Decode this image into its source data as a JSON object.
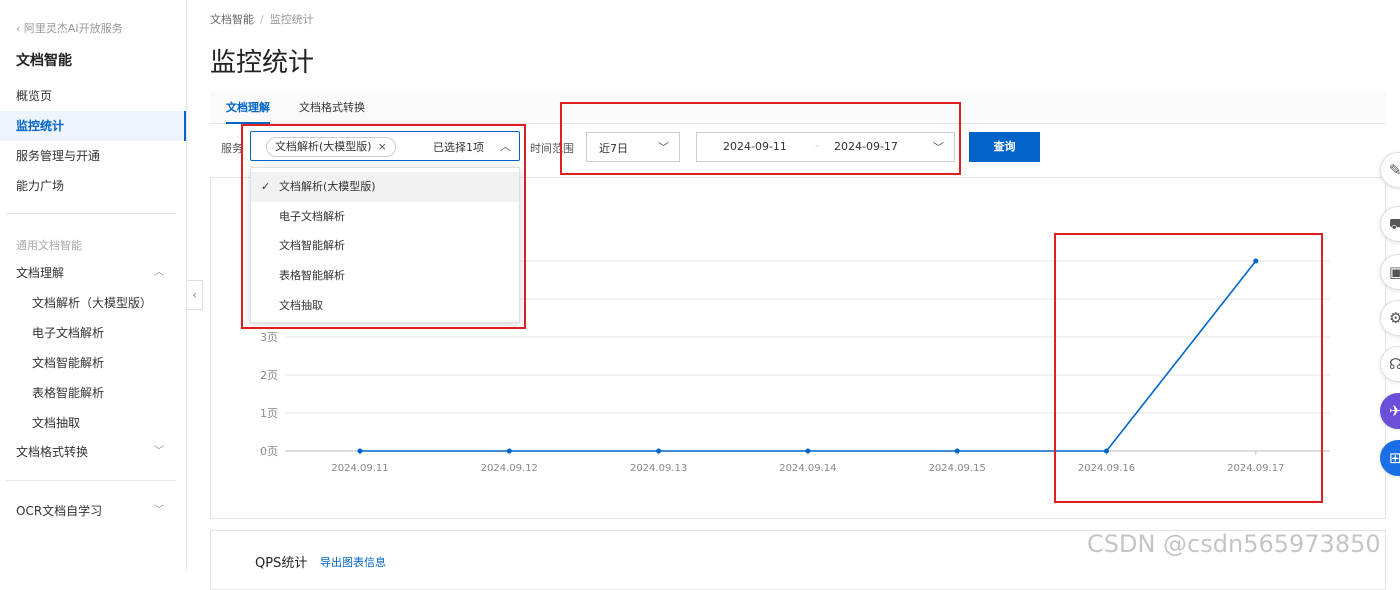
{
  "sidebar": {
    "back_label": "阿里灵杰AI开放服务",
    "product_title": "文档智能",
    "top_items": [
      {
        "label": "概览页"
      },
      {
        "label": "监控统计"
      },
      {
        "label": "服务管理与开通"
      },
      {
        "label": "能力广场"
      }
    ],
    "group_label": "通用文档智能",
    "understanding": {
      "label": "文档理解",
      "children": [
        {
          "label": "文档解析（大模型版）"
        },
        {
          "label": "电子文档解析"
        },
        {
          "label": "文档智能解析"
        },
        {
          "label": "表格智能解析"
        },
        {
          "label": "文档抽取"
        }
      ]
    },
    "format_convert": {
      "label": "文档格式转换"
    },
    "ocr_learning": {
      "label": "OCR文档自学习"
    }
  },
  "breadcrumb": {
    "root": "文档智能",
    "sep": "/",
    "current": "监控统计"
  },
  "page_title": "监控统计",
  "tabs": [
    {
      "label": "文档理解"
    },
    {
      "label": "文档格式转换"
    }
  ],
  "filters": {
    "service_label": "服务",
    "selected_tag": "文档解析(大模型版)",
    "tag_close": "×",
    "selected_count": "已选择1项",
    "options": [
      {
        "label": "文档解析(大模型版)",
        "checked": true
      },
      {
        "label": "电子文档解析"
      },
      {
        "label": "文档智能解析"
      },
      {
        "label": "表格智能解析"
      },
      {
        "label": "文档抽取"
      }
    ],
    "time_label": "时间范围",
    "range_value": "近7日",
    "date_start": "2024-09-11",
    "date_sep": "-",
    "date_end": "2024-09-17",
    "query_label": "查询"
  },
  "chart_data": {
    "type": "line",
    "x": [
      "2024.09.11",
      "2024.09.12",
      "2024.09.13",
      "2024.09.14",
      "2024.09.15",
      "2024.09.16",
      "2024.09.17"
    ],
    "series": [
      {
        "values": [
          0,
          0,
          0,
          0,
          0,
          0,
          5
        ]
      }
    ],
    "y_ticks": [
      "0页",
      "1页",
      "2页",
      "3页"
    ],
    "ylim": [
      0,
      5
    ],
    "grid": true,
    "line_color": "#0064c8"
  },
  "qps": {
    "title": "QPS统计",
    "export_label": "导出图表信息"
  },
  "watermark": "CSDN @csdn565973850",
  "icons": [
    "edit-icon",
    "cart-icon",
    "monitor-icon",
    "gear-icon",
    "headset-icon",
    "send-icon",
    "apps-icon"
  ]
}
